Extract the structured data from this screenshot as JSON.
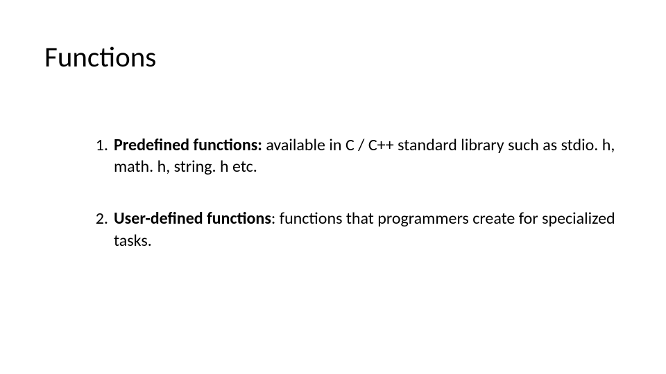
{
  "title": "Functions",
  "items": [
    {
      "num": "1.",
      "bold": "Predefined functions:",
      "rest": " available in C / C++ standard library such as stdio. h, math. h, string. h etc."
    },
    {
      "num": "2.",
      "bold": "User-defined functions",
      "rest": ": functions that programmers create for specialized tasks."
    }
  ]
}
